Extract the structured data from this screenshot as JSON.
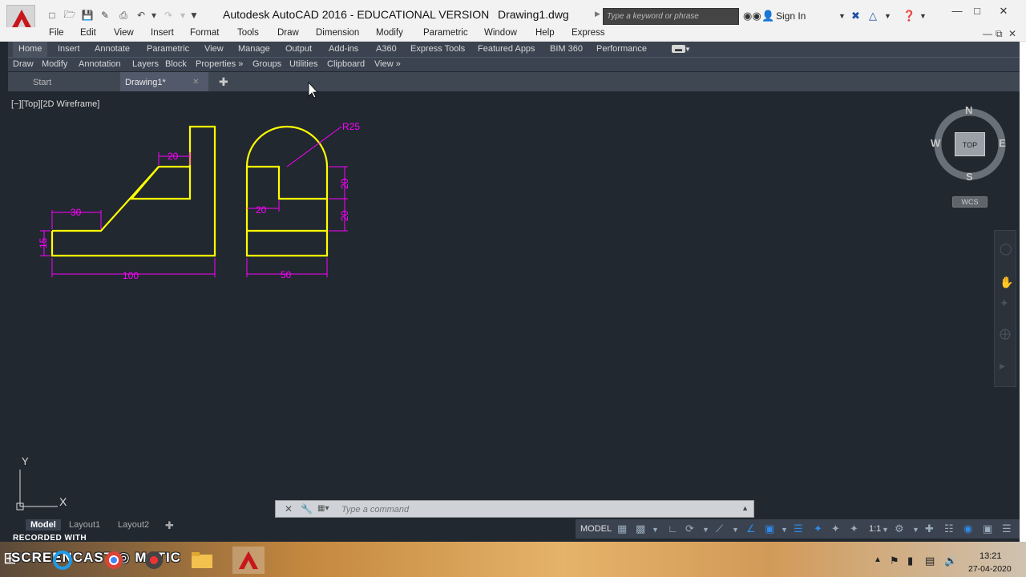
{
  "window": {
    "title": "Autodesk AutoCAD 2016 - EDUCATIONAL VERSION",
    "file": "Drawing1.dwg",
    "search_placeholder": "Type a keyword or phrase",
    "sign_in": "Sign In"
  },
  "menu": [
    "File",
    "Edit",
    "View",
    "Insert",
    "Format",
    "Tools",
    "Draw",
    "Dimension",
    "Modify",
    "Parametric",
    "Window",
    "Help",
    "Express"
  ],
  "ribbon_tabs": [
    "Home",
    "Insert",
    "Annotate",
    "Parametric",
    "View",
    "Manage",
    "Output",
    "Add-ins",
    "A360",
    "Express Tools",
    "Featured Apps",
    "BIM 360",
    "Performance"
  ],
  "ribbon_panels": [
    "Draw",
    "Modify",
    "Annotation",
    "Layers",
    "Block",
    "Properties »",
    "Groups",
    "Utilities",
    "Clipboard",
    "View »"
  ],
  "file_tabs": {
    "start": "Start",
    "drawing": "Drawing1*"
  },
  "viewport": {
    "label": "[−][Top][2D Wireframe]"
  },
  "dimensions": {
    "d100": "100",
    "d30": "30",
    "d20_top": "20",
    "d15": "15",
    "d50": "50",
    "d20_inner": "20",
    "d20_right_top": "20",
    "d20_right_bottom": "20",
    "r25": "R25"
  },
  "viewcube": {
    "north": "N",
    "south": "S",
    "east": "E",
    "west": "W",
    "top": "TOP",
    "wcs": "WCS"
  },
  "ucs": {
    "x": "X",
    "y": "Y"
  },
  "command": {
    "placeholder": "Type a command"
  },
  "layout_tabs": [
    "Model",
    "Layout1",
    "Layout2"
  ],
  "status": {
    "model": "MODEL",
    "scale": "1:1"
  },
  "watermark": {
    "recorded_with": "RECORDED WITH",
    "brand": "SCREENCAST ◎ MATIC"
  },
  "clock": {
    "time": "13:21",
    "date": "27-04-2020"
  },
  "colors": {
    "geometry": "#ffff00",
    "dimension": "#ff00ff",
    "background": "#212830"
  }
}
